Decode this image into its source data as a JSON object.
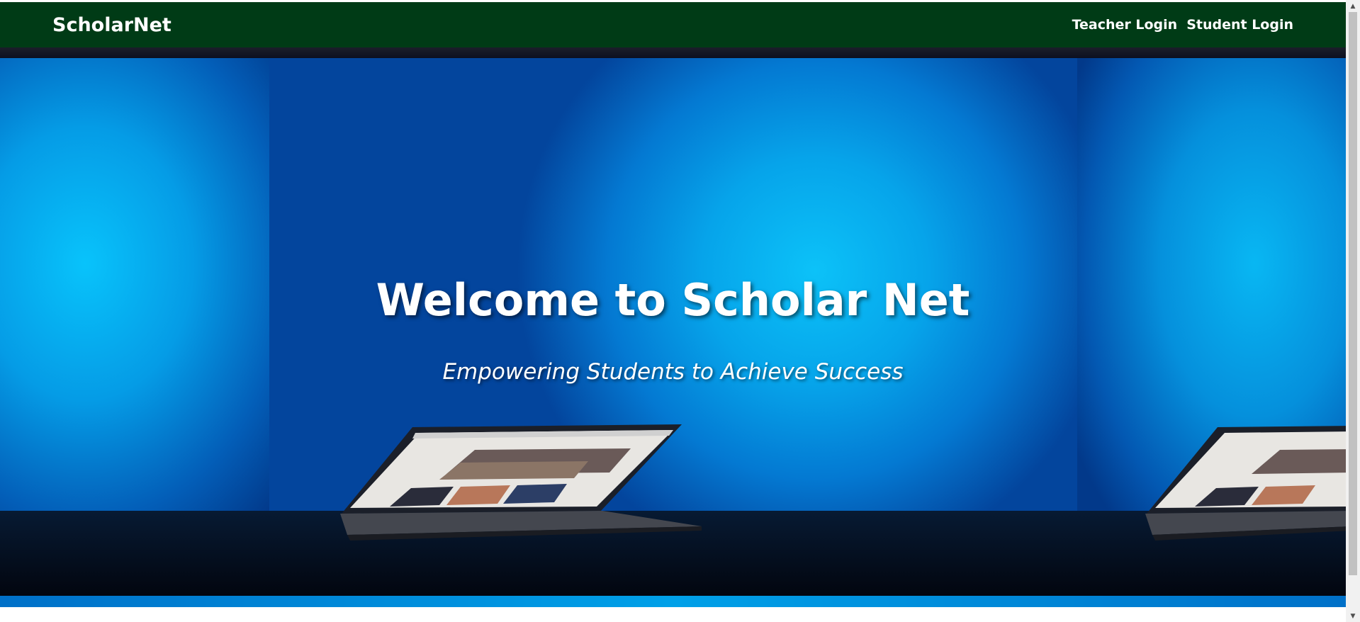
{
  "navbar": {
    "brand": "ScholarNet",
    "links": [
      {
        "label": "Teacher Login"
      },
      {
        "label": "Student Login"
      }
    ],
    "background_color": "#003b16"
  },
  "hero": {
    "title": "Welcome to Scholar Net",
    "subtitle": "Empowering Students to Achieve Success",
    "image_description_icon": "laptop-image"
  },
  "scrollbar": {
    "up_icon": "▲",
    "down_icon": "▼"
  }
}
